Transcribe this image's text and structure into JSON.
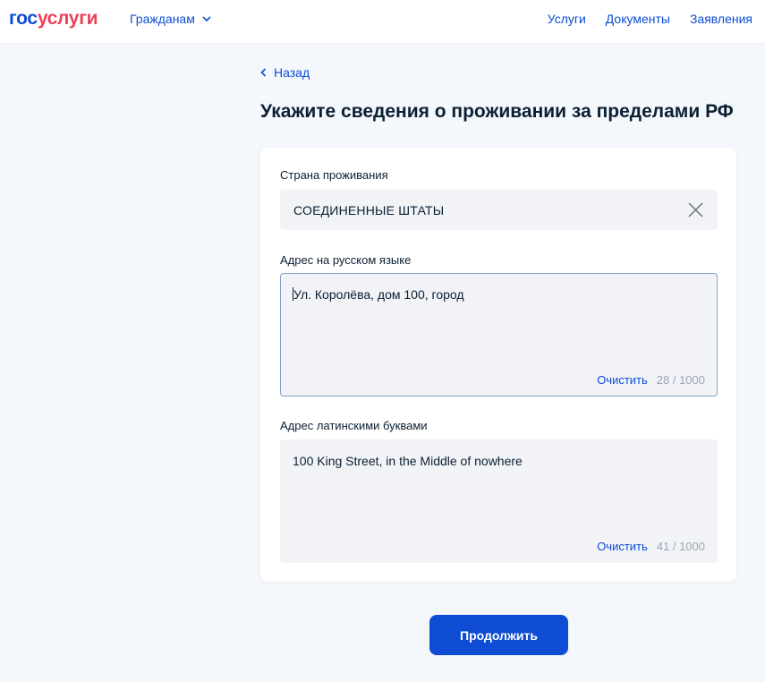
{
  "header": {
    "logo_part1": "гос",
    "logo_part2": "услуги",
    "citizens_menu": "Гражданам",
    "nav": [
      "Услуги",
      "Документы",
      "Заявления"
    ]
  },
  "back_label": "Назад",
  "page_title": "Укажите сведения о проживании за пределами РФ",
  "form": {
    "country": {
      "label": "Страна проживания",
      "value": "СОЕДИНЕННЫЕ ШТАТЫ"
    },
    "address_ru": {
      "label": "Адрес на русском языке",
      "value": "Ул. Королёва, дом 100, город",
      "clear_label": "Очистить",
      "counter": "28 / 1000"
    },
    "address_lat": {
      "label": "Адрес латинскими буквами",
      "value": "100 King Street, in the Middle of nowhere",
      "clear_label": "Очистить",
      "counter": "41 / 1000"
    }
  },
  "continue_label": "Продолжить",
  "colors": {
    "brand_blue": "#0d4cd3",
    "brand_red": "#ee3f58",
    "background": "#f4f7fb",
    "muted": "#9aa7b5"
  }
}
